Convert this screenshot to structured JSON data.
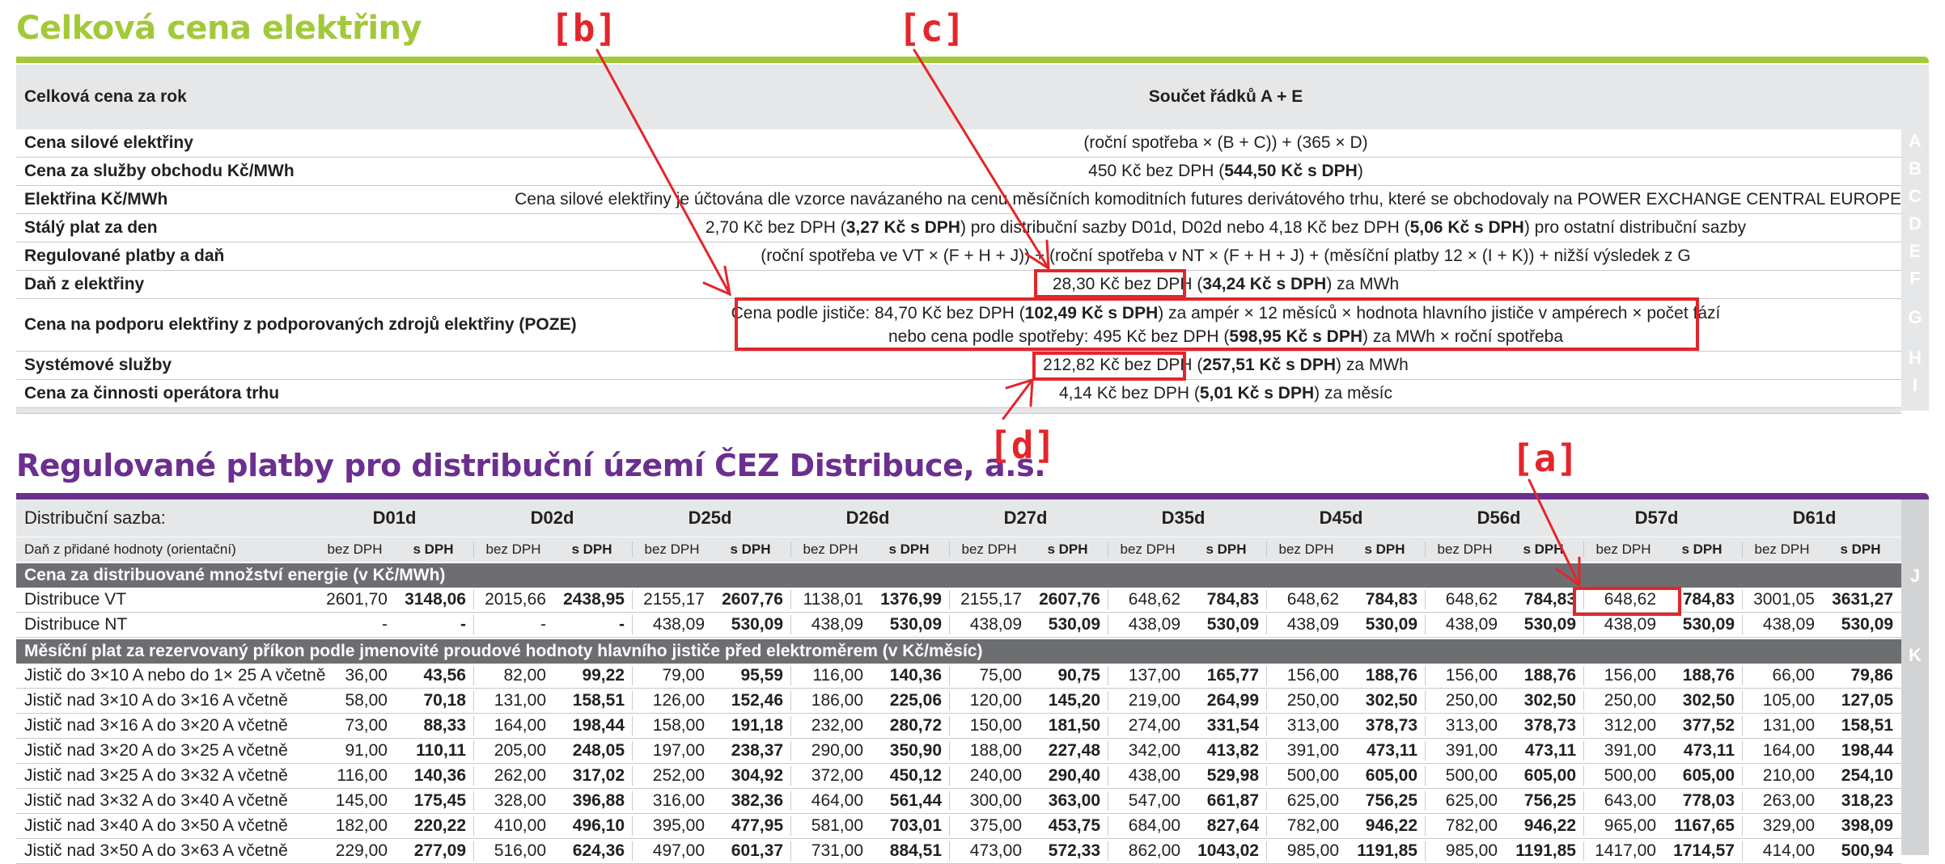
{
  "section1": {
    "title": "Celková cena elektřiny",
    "header": {
      "label": "Celková cena za rok",
      "value": "Součet řádků A + E"
    },
    "rows": [
      {
        "letter": "A",
        "label": "Cena silové elektřiny",
        "value": "(roční spotřeba × (B + C)) + (365 × D)"
      },
      {
        "letter": "B",
        "label": "Cena za služby obchodu Kč/MWh",
        "value_pre": "450 Kč bez DPH (",
        "value_bold": "544,50 Kč s DPH",
        "value_post": ")"
      },
      {
        "letter": "C",
        "label": "Elektřina Kč/MWh",
        "value": "Cena silové elektřiny je účtována dle vzorce navázaného na cenu měsíčních komoditních futures derivátového trhu, které se obchodovaly na POWER EXCHANGE CENTRAL EUROPE"
      },
      {
        "letter": "D",
        "label": "Stálý plat za den",
        "value_pre": "2,70 Kč bez DPH (",
        "value_bold": "3,27 Kč s DPH",
        "value_mid": ") pro distribuční sazby D01d, D02d nebo 4,18 Kč bez DPH (",
        "value_bold2": "5,06 Kč s DPH",
        "value_post": ") pro ostatní distribuční sazby"
      },
      {
        "letter": "E",
        "label": "Regulované platby a daň",
        "value": "(roční spotřeba ve VT × (F + H + J)) + (roční spotřeba v NT × (F + H + J) + (měsíční platby 12 × (I + K)) + nižší výsledek z G"
      },
      {
        "letter": "F",
        "label": "Daň z elektřiny",
        "value_pre": "28,30 Kč bez DPH (",
        "value_bold": "34,24 Kč s DPH",
        "value_post": ") za MWh"
      },
      {
        "letter": "G",
        "label": "Cena na podporu elektřiny z podporovaných zdrojů elektřiny (POZE)",
        "line1_pre": "Cena podle jističe: 84,70 Kč bez DPH (",
        "line1_bold": "102,49 Kč s DPH",
        "line1_post": ") za ampér × 12 měsíců × hodnota hlavního jističe v ampérech × počet fází",
        "line2_pre": "nebo cena podle spotřeby: 495 Kč bez DPH (",
        "line2_bold": "598,95 Kč s DPH",
        "line2_post": ") za MWh × roční spotřeba"
      },
      {
        "letter": "H",
        "label": "Systémové služby",
        "value_pre": "212,82 Kč bez DPH (",
        "value_bold": "257,51 Kč s DPH",
        "value_post": ") za MWh"
      },
      {
        "letter": "I",
        "label": "Cena za činnosti operátora trhu",
        "value_pre": "4,14 Kč bez DPH (",
        "value_bold": "5,01 Kč s DPH",
        "value_post": ") za měsíc"
      }
    ]
  },
  "section2": {
    "title": "Regulované platby pro distribuční území ČEZ Distribuce, a.s.",
    "header_label": "Distribuční sazba:",
    "vat_label": "Daň z přidané hodnoty (orientační)",
    "col_excl": "bez DPH",
    "col_incl": "s DPH",
    "rates": [
      "D01d",
      "D02d",
      "D25d",
      "D26d",
      "D27d",
      "D35d",
      "D45d",
      "D56d",
      "D57d",
      "D61d"
    ],
    "energy_section": {
      "title": "Cena za distribuované množství energie (v Kč/MWh)",
      "letter": "J"
    },
    "energy_rows": [
      {
        "label": "Distribuce VT",
        "values": [
          "2601,70",
          "3148,06",
          "2015,66",
          "2438,95",
          "2155,17",
          "2607,76",
          "1138,01",
          "1376,99",
          "2155,17",
          "2607,76",
          "648,62",
          "784,83",
          "648,62",
          "784,83",
          "648,62",
          "784,83",
          "648,62",
          "784,83",
          "3001,05",
          "3631,27"
        ]
      },
      {
        "label": "Distribuce NT",
        "values": [
          "-",
          "-",
          "-",
          "-",
          "438,09",
          "530,09",
          "438,09",
          "530,09",
          "438,09",
          "530,09",
          "438,09",
          "530,09",
          "438,09",
          "530,09",
          "438,09",
          "530,09",
          "438,09",
          "530,09",
          "438,09",
          "530,09"
        ]
      }
    ],
    "breaker_section": {
      "title": "Měsíční plat za rezervovaný příkon podle jmenovité proudové hodnoty hlavního jističe před elektroměrem (v Kč/měsíc)",
      "letter": "K"
    },
    "breaker_rows": [
      {
        "label": "Jistič do 3×10 A nebo do 1× 25 A včetně",
        "values": [
          "36,00",
          "43,56",
          "82,00",
          "99,22",
          "79,00",
          "95,59",
          "116,00",
          "140,36",
          "75,00",
          "90,75",
          "137,00",
          "165,77",
          "156,00",
          "188,76",
          "156,00",
          "188,76",
          "156,00",
          "188,76",
          "66,00",
          "79,86"
        ]
      },
      {
        "label": "Jistič nad 3×10 A do 3×16 A včetně",
        "values": [
          "58,00",
          "70,18",
          "131,00",
          "158,51",
          "126,00",
          "152,46",
          "186,00",
          "225,06",
          "120,00",
          "145,20",
          "219,00",
          "264,99",
          "250,00",
          "302,50",
          "250,00",
          "302,50",
          "250,00",
          "302,50",
          "105,00",
          "127,05"
        ]
      },
      {
        "label": "Jistič nad 3×16 A do 3×20 A včetně",
        "values": [
          "73,00",
          "88,33",
          "164,00",
          "198,44",
          "158,00",
          "191,18",
          "232,00",
          "280,72",
          "150,00",
          "181,50",
          "274,00",
          "331,54",
          "313,00",
          "378,73",
          "313,00",
          "378,73",
          "312,00",
          "377,52",
          "131,00",
          "158,51"
        ]
      },
      {
        "label": "Jistič nad 3×20 A do 3×25 A včetně",
        "values": [
          "91,00",
          "110,11",
          "205,00",
          "248,05",
          "197,00",
          "238,37",
          "290,00",
          "350,90",
          "188,00",
          "227,48",
          "342,00",
          "413,82",
          "391,00",
          "473,11",
          "391,00",
          "473,11",
          "391,00",
          "473,11",
          "164,00",
          "198,44"
        ]
      },
      {
        "label": "Jistič nad 3×25 A do 3×32 A včetně",
        "values": [
          "116,00",
          "140,36",
          "262,00",
          "317,02",
          "252,00",
          "304,92",
          "372,00",
          "450,12",
          "240,00",
          "290,40",
          "438,00",
          "529,98",
          "500,00",
          "605,00",
          "500,00",
          "605,00",
          "500,00",
          "605,00",
          "210,00",
          "254,10"
        ]
      },
      {
        "label": "Jistič nad 3×32 A do 3×40 A včetně",
        "values": [
          "145,00",
          "175,45",
          "328,00",
          "396,88",
          "316,00",
          "382,36",
          "464,00",
          "561,44",
          "300,00",
          "363,00",
          "547,00",
          "661,87",
          "625,00",
          "756,25",
          "625,00",
          "756,25",
          "643,00",
          "778,03",
          "263,00",
          "318,23"
        ]
      },
      {
        "label": "Jistič nad 3×40 A do 3×50 A včetně",
        "values": [
          "182,00",
          "220,22",
          "410,00",
          "496,10",
          "395,00",
          "477,95",
          "581,00",
          "703,01",
          "375,00",
          "453,75",
          "684,00",
          "827,64",
          "782,00",
          "946,22",
          "782,00",
          "946,22",
          "965,00",
          "1167,65",
          "329,00",
          "398,09"
        ]
      },
      {
        "label": "Jistič nad 3×50 A do 3×63 A včetně",
        "values": [
          "229,00",
          "277,09",
          "516,00",
          "624,36",
          "497,00",
          "601,37",
          "731,00",
          "884,51",
          "473,00",
          "572,33",
          "862,00",
          "1043,02",
          "985,00",
          "1191,85",
          "985,00",
          "1191,85",
          "1417,00",
          "1714,57",
          "414,00",
          "500,94"
        ]
      }
    ]
  },
  "annotations": {
    "a": "[a]",
    "b": "[b]",
    "c": "[c]",
    "d": "[d]",
    "color": "#e3262b"
  },
  "colors": {
    "green": "#a3c93a",
    "purple": "#6b2f8f",
    "section_bar": "#6d6e71",
    "header_bg": "#e6e7e8"
  }
}
